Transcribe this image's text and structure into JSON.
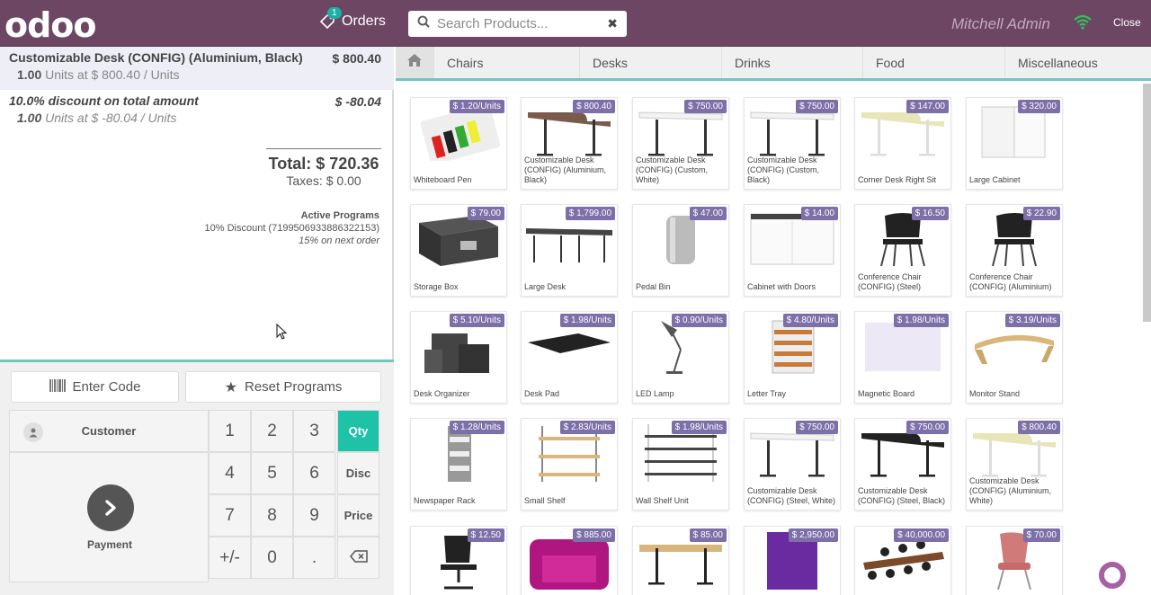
{
  "header": {
    "logo": "odoo",
    "orders_label": "Orders",
    "orders_count": "1",
    "search_placeholder": "Search Products...",
    "user": "Mitchell Admin",
    "close_label": "Close"
  },
  "order": {
    "lines": [
      {
        "name": "Customizable Desk (CONFIG) (Aluminium, Black)",
        "price": "$ 800.40",
        "qty": "1.00",
        "info": "Units at $ 800.40 / Units"
      },
      {
        "name": "10.0% discount on total amount",
        "price": "$ -80.04",
        "qty": "1.00",
        "info": "Units at $ -80.04 / Units"
      }
    ],
    "total": "Total: $ 720.36",
    "taxes": "Taxes: $ 0.00",
    "programs_header": "Active Programs",
    "program_1": "10% Discount (7199506933886322153)",
    "program_2": "15% on next order"
  },
  "controls": {
    "enter_code": "Enter Code",
    "reset_programs": "Reset Programs",
    "customer": "Customer",
    "payment": "Payment",
    "keys": [
      "1",
      "2",
      "3",
      "4",
      "5",
      "6",
      "7",
      "8",
      "9",
      "+/-",
      "0",
      "."
    ],
    "modes": [
      "Qty",
      "Disc",
      "Price"
    ]
  },
  "categories": [
    "Chairs",
    "Desks",
    "Drinks",
    "Food",
    "Miscellaneous"
  ],
  "products": [
    {
      "name": "Whiteboard Pen",
      "price": "$ 1.20/Units",
      "icon": "pen"
    },
    {
      "name": "Customizable Desk (CONFIG) (Aluminium, Black)",
      "price": "$ 800.40",
      "icon": "desk-dark"
    },
    {
      "name": "Customizable Desk (CONFIG) (Custom, White)",
      "price": "$ 750.00",
      "icon": "desk-white"
    },
    {
      "name": "Customizable Desk (CONFIG) (Custom, Black)",
      "price": "$ 750.00",
      "icon": "desk-white"
    },
    {
      "name": "Corner Desk Right Sit",
      "price": "$ 147.00",
      "icon": "desk-corner"
    },
    {
      "name": "Large Cabinet",
      "price": "$ 320.00",
      "icon": "cabinet"
    },
    {
      "name": "Storage Box",
      "price": "$ 79.00",
      "icon": "box"
    },
    {
      "name": "Large Desk",
      "price": "$ 1,799.00",
      "icon": "desk-large"
    },
    {
      "name": "Pedal Bin",
      "price": "$ 47.00",
      "icon": "bin"
    },
    {
      "name": "Cabinet with Doors",
      "price": "$ 14.00",
      "icon": "cabinet-doors"
    },
    {
      "name": "Conference Chair (CONFIG) (Steel)",
      "price": "$ 16.50",
      "icon": "chair"
    },
    {
      "name": "Conference Chair (CONFIG) (Aluminium)",
      "price": "$ 22.90",
      "icon": "chair"
    },
    {
      "name": "Desk Organizer",
      "price": "$ 5.10/Units",
      "icon": "organizer"
    },
    {
      "name": "Desk Pad",
      "price": "$ 1.98/Units",
      "icon": "pad"
    },
    {
      "name": "LED Lamp",
      "price": "$ 0.90/Units",
      "icon": "lamp"
    },
    {
      "name": "Letter Tray",
      "price": "$ 4.80/Units",
      "icon": "tray"
    },
    {
      "name": "Magnetic Board",
      "price": "$ 1.98/Units",
      "icon": "board"
    },
    {
      "name": "Monitor Stand",
      "price": "$ 3.19/Units",
      "icon": "stand"
    },
    {
      "name": "Newspaper Rack",
      "price": "$ 1.28/Units",
      "icon": "rack"
    },
    {
      "name": "Small Shelf",
      "price": "$ 2.83/Units",
      "icon": "shelf"
    },
    {
      "name": "Wall Shelf Unit",
      "price": "$ 1.98/Units",
      "icon": "wall-shelf"
    },
    {
      "name": "Customizable Desk (CONFIG) (Steel, White)",
      "price": "$ 750.00",
      "icon": "desk-white"
    },
    {
      "name": "Customizable Desk (CONFIG) (Steel, Black)",
      "price": "$ 750.00",
      "icon": "desk-black"
    },
    {
      "name": "Customizable Desk (CONFIG) (Aluminium, White)",
      "price": "$ 800.40",
      "icon": "desk-corner"
    },
    {
      "name": "",
      "price": "$ 12.50",
      "icon": "office-chair"
    },
    {
      "name": "",
      "price": "$ 885.00",
      "icon": "booth"
    },
    {
      "name": "",
      "price": "$ 85.00",
      "icon": "desk-wood"
    },
    {
      "name": "",
      "price": "$ 2,950.00",
      "icon": "panel"
    },
    {
      "name": "",
      "price": "$ 40,000.00",
      "icon": "conference-table"
    },
    {
      "name": "",
      "price": "$ 70.00",
      "icon": "pink-chair"
    }
  ],
  "colors": {
    "header": "#6d4663",
    "accent": "#1ec3a7",
    "price_tag": "#7d6fa8"
  }
}
